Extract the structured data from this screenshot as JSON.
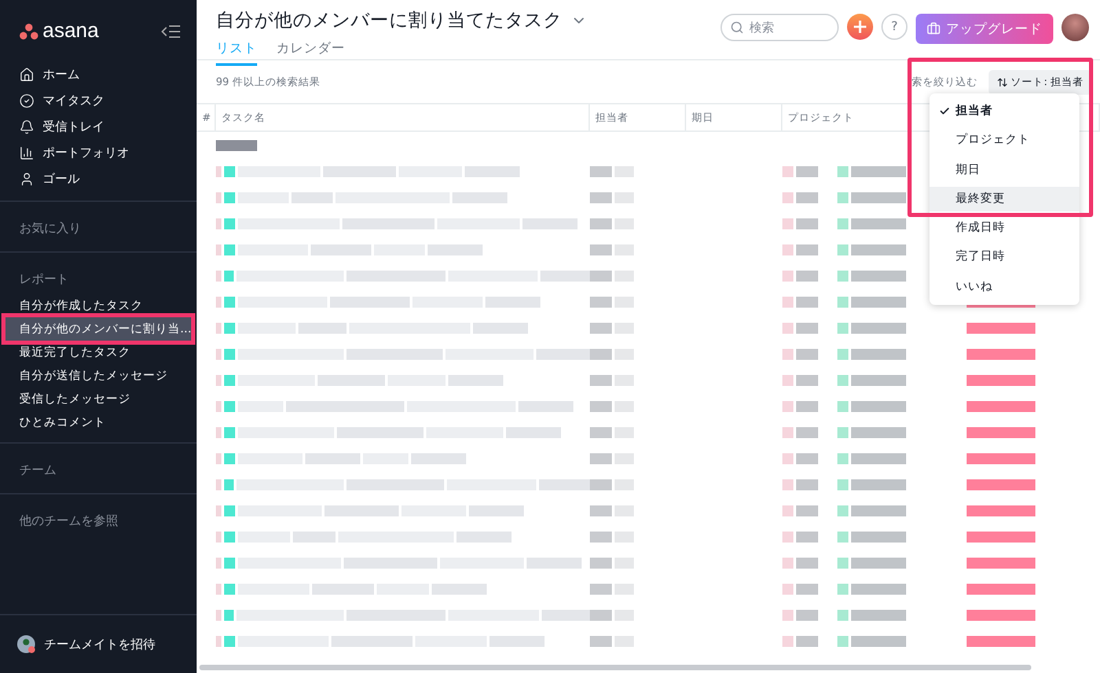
{
  "sidebar": {
    "logo": "asana",
    "nav": [
      {
        "label": "ホーム"
      },
      {
        "label": "マイタスク"
      },
      {
        "label": "受信トレイ"
      },
      {
        "label": "ポートフォリオ"
      },
      {
        "label": "ゴール"
      }
    ],
    "favorites_heading": "お気に入り",
    "reports_heading": "レポート",
    "reports": [
      {
        "label": "自分が作成したタスク",
        "selected": false
      },
      {
        "label": "自分が他のメンバーに割り当...",
        "selected": true
      },
      {
        "label": "最近完了したタスク",
        "selected": false
      },
      {
        "label": "自分が送信したメッセージ",
        "selected": false
      },
      {
        "label": "受信したメッセージ",
        "selected": false
      },
      {
        "label": "ひとみコメント",
        "selected": false
      }
    ],
    "team_heading": "チーム",
    "browse_teams": "他のチームを参照",
    "invite": "チームメイトを招待"
  },
  "header": {
    "title": "自分が他のメンバーに割り当てたタスク",
    "tabs": [
      {
        "label": "リスト",
        "selected": true
      },
      {
        "label": "カレンダー",
        "selected": false
      }
    ],
    "search": {
      "placeholder": "検索"
    },
    "help": "?",
    "upgrade": "アップグレード"
  },
  "toolbar": {
    "result_count": "99 件以上の検索結果",
    "filter": "索を絞り込む",
    "sort": "ソート: 担当者"
  },
  "table": {
    "columns": [
      "#",
      "タスク名",
      "担当者",
      "期日",
      "プロジェクト"
    ],
    "rows": [
      {
        "kind": "group"
      },
      {
        "kind": "task"
      },
      {
        "kind": "task"
      },
      {
        "kind": "task"
      },
      {
        "kind": "task"
      },
      {
        "kind": "task"
      },
      {
        "kind": "task"
      },
      {
        "kind": "task"
      },
      {
        "kind": "task"
      },
      {
        "kind": "task"
      },
      {
        "kind": "task"
      },
      {
        "kind": "task"
      },
      {
        "kind": "task"
      },
      {
        "kind": "task"
      },
      {
        "kind": "task"
      },
      {
        "kind": "task"
      },
      {
        "kind": "task"
      },
      {
        "kind": "task"
      },
      {
        "kind": "task"
      },
      {
        "kind": "task"
      }
    ]
  },
  "sort_menu": {
    "items": [
      {
        "label": "担当者",
        "selected": true,
        "hovered": false
      },
      {
        "label": "プロジェクト",
        "selected": false,
        "hovered": false
      },
      {
        "label": "期日",
        "selected": false,
        "hovered": false
      },
      {
        "label": "最終変更",
        "selected": false,
        "hovered": true
      },
      {
        "label": "作成日時",
        "selected": false,
        "hovered": false
      },
      {
        "label": "完了日時",
        "selected": false,
        "hovered": false
      },
      {
        "label": "いいね",
        "selected": false,
        "hovered": false
      }
    ]
  }
}
